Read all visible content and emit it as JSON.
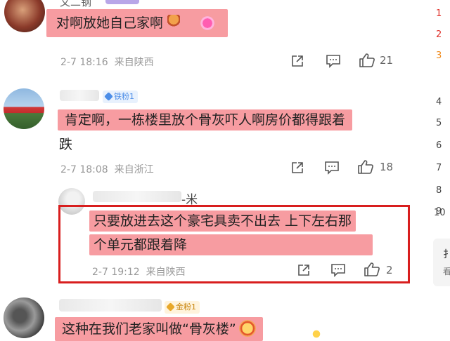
{
  "comments": [
    {
      "user_fragment": "文二钢",
      "text_lines": [
        "对啊放她自己家啊"
      ],
      "date": "2-7 18:16",
      "location": "来自陕西",
      "likes": "21"
    },
    {
      "badge": "铁粉1",
      "text_lines": [
        "肯定啊，一栋楼里放个骨灰吓人啊房价都得跟着",
        "跌"
      ],
      "date": "2-7 18:08",
      "location": "来自浙江",
      "likes": "18"
    },
    {
      "user_suffix": "-米",
      "text_lines": [
        "只要放进去这个豪宅具卖不出去 上下左右那",
        "个单元都跟着降"
      ],
      "date": "2-7 19:12",
      "location": "来自陕西",
      "likes": "2"
    },
    {
      "badge": "金粉1",
      "text_lines": [
        "这种在我们老家叫做“骨灰楼”"
      ]
    }
  ],
  "sidebar": {
    "rank_numbers": [
      "1",
      "2",
      "3",
      "4",
      "5",
      "6",
      "7",
      "8",
      "9",
      "10"
    ],
    "card_chars": [
      "扌",
      "看"
    ]
  },
  "colors": {
    "highlight": "#f47b81",
    "rank_red": "#e0312a",
    "rank_orange": "#f08a1b",
    "badge_blue": "#4d8ee8",
    "badge_gold": "#e8a82a",
    "box_red": "#d81e1e"
  }
}
